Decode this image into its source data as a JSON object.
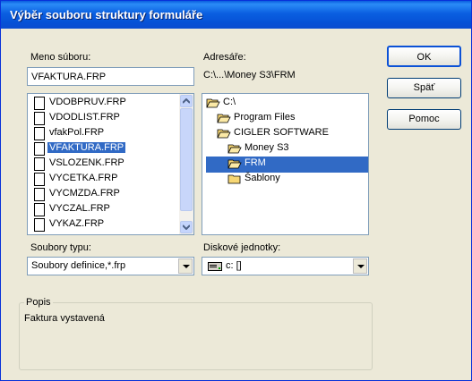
{
  "window": {
    "title": "Výběr souboru struktury formuláře"
  },
  "filename": {
    "label": "Meno súboru:",
    "value": "VFAKTURA.FRP"
  },
  "directory": {
    "label": "Adresáře:",
    "path": "C:\\...\\Money S3\\FRM"
  },
  "files": [
    "VDOBPRUV.FRP",
    "VDODLIST.FRP",
    "vfakPol.FRP",
    "VFAKTURA.FRP",
    "VSLOZENK.FRP",
    "VYCETKA.FRP",
    "VYCMZDA.FRP",
    "VYCZAL.FRP",
    "VYKAZ.FRP"
  ],
  "selected_file": "VFAKTURA.FRP",
  "folders": [
    "C:\\",
    "Program Files",
    "CIGLER SOFTWARE",
    "Money S3",
    "FRM",
    "Šablony"
  ],
  "selected_folder": "FRM",
  "file_type": {
    "label": "Soubory typu:",
    "value": "Soubory definice,*.frp"
  },
  "drives": {
    "label": "Diskové jednotky:",
    "value": "c: []"
  },
  "buttons": {
    "ok": "OK",
    "back": "Späť",
    "help": "Pomoc"
  },
  "description": {
    "label": "Popis",
    "text": "Faktura vystavená"
  },
  "colors": {
    "title_bar": "#0a5fe1",
    "selection": "#316ac5",
    "folder": "#f7d774",
    "dialog_bg": "#ece9d8"
  }
}
